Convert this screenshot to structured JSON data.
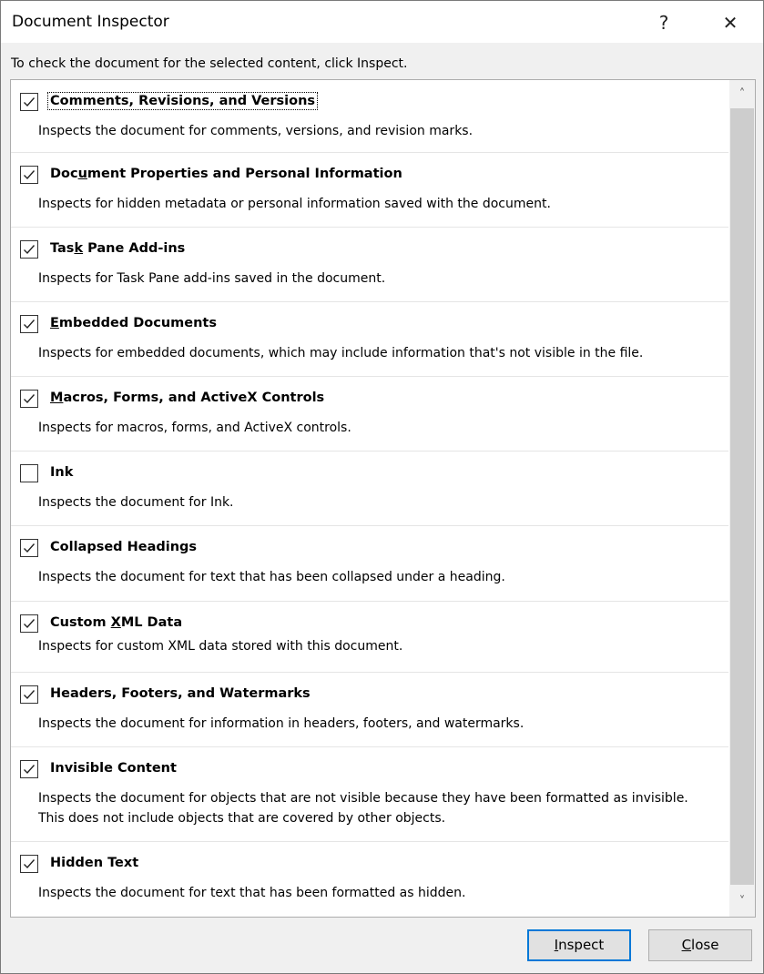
{
  "window": {
    "title": "Document Inspector",
    "help_label": "?",
    "close_label": "✕"
  },
  "instruction": "To check the document for the selected content, click Inspect.",
  "items": [
    {
      "pre": "Comments, Revisions, and Versions",
      "key": "",
      "post": "",
      "checked": true,
      "desc": "Inspects the document for comments, versions, and revision marks."
    },
    {
      "pre": "Doc",
      "key": "u",
      "post": "ment Properties and Personal Information",
      "checked": true,
      "desc": "Inspects for hidden metadata or personal information saved with the document."
    },
    {
      "pre": "Tas",
      "key": "k",
      "post": " Pane Add-ins",
      "checked": true,
      "desc": "Inspects for Task Pane add-ins saved in the document."
    },
    {
      "pre": "",
      "key": "E",
      "post": "mbedded Documents",
      "checked": true,
      "desc": "Inspects for embedded documents, which may include information that's not visible in the file."
    },
    {
      "pre": "",
      "key": "M",
      "post": "acros, Forms, and ActiveX Controls",
      "checked": true,
      "desc": "Inspects for macros, forms, and ActiveX controls."
    },
    {
      "pre": "Ink",
      "key": "",
      "post": "",
      "checked": false,
      "desc": "Inspects the document for Ink."
    },
    {
      "pre": "Collapsed Headings",
      "key": "",
      "post": "",
      "checked": true,
      "desc": "Inspects the document for text that has been collapsed under a heading."
    },
    {
      "pre": "Custom ",
      "key": "X",
      "post": "ML Data",
      "checked": true,
      "desc": "Inspects for custom XML data stored with this document."
    },
    {
      "pre": "Headers, Footers, and Watermarks",
      "key": "",
      "post": "",
      "checked": true,
      "desc": "Inspects the document for information in headers, footers, and watermarks."
    },
    {
      "pre": "Invisible Content",
      "key": "",
      "post": "",
      "checked": true,
      "desc": "Inspects the document for objects that are not visible because they have been formatted as invisible.\nThis does not include objects that are covered by other objects."
    },
    {
      "pre": "Hidden Text",
      "key": "",
      "post": "",
      "checked": true,
      "desc": "Inspects the document for text that has been formatted as hidden."
    }
  ],
  "buttons": {
    "inspect": {
      "key": "I",
      "rest": "nspect"
    },
    "close": {
      "key": "C",
      "rest": "lose"
    }
  },
  "colors": {
    "accent": "#0078d7",
    "background": "#f0f0f0"
  }
}
